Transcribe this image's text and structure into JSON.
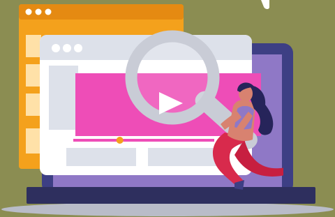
{
  "colors": {
    "background": "#8b8d52",
    "orange_window": "#f4a11c",
    "orange_titlebar": "#e58a12",
    "laptop_frame": "#3d3f84",
    "laptop_screen": "#8f78c6",
    "laptop_base": "#2e2f5e",
    "browser_window": "#ffffff",
    "browser_titlebar": "#dde1ea",
    "video_frame": "#ee4db7",
    "progress_dot": "#f4a11c",
    "magnifier_ring": "#c9ccd6",
    "woman_skin": "#d88270",
    "woman_hair": "#26245a",
    "woman_pants": "#d82a4c"
  },
  "video_player": {
    "progress_fraction": 0.33
  },
  "illustration": {
    "subject": "woman-with-magnifying-glass",
    "icons": [
      "play-icon",
      "window-dots-icon",
      "magnifying-glass-icon"
    ]
  }
}
